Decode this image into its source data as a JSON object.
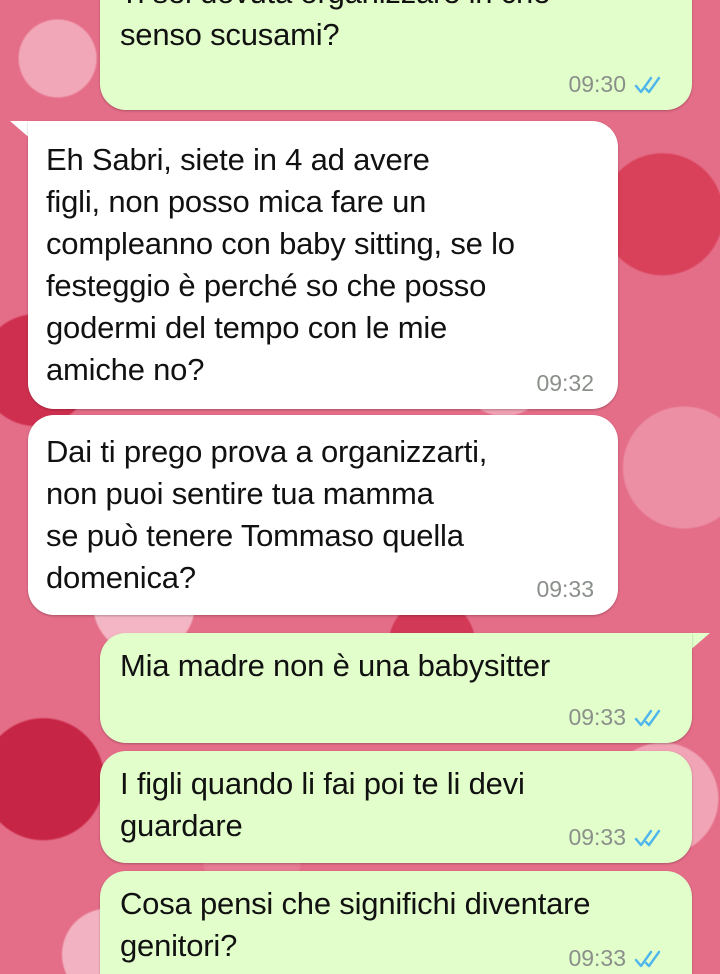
{
  "colors": {
    "outgoing_bubble": "#e2fecb",
    "incoming_bubble": "#ffffff",
    "timestamp": "#8a8f8a",
    "read_ticks": "#4fb6ec"
  },
  "messages": [
    {
      "direction": "outgoing",
      "text": "Ti sei dovuta organizzare in che\nsenso scusami?",
      "time": "09:30",
      "read": true
    },
    {
      "direction": "incoming",
      "text": "Eh Sabri, siete in 4 ad avere\nfigli, non posso mica fare un\ncompleanno con baby sitting, se lo\nfesteggio è perché so che posso\ngodermi del tempo con le mie\namiche no?",
      "time": "09:32"
    },
    {
      "direction": "incoming",
      "text": "Dai ti prego prova a organizzarti,\nnon puoi sentire tua mamma\nse può tenere Tommaso quella\ndomenica?",
      "time": "09:33"
    },
    {
      "direction": "outgoing",
      "text": "Mia madre non è una babysitter",
      "time": "09:33",
      "read": true
    },
    {
      "direction": "outgoing",
      "text": "I figli quando li fai poi te li devi\nguardare",
      "time": "09:33",
      "read": true
    },
    {
      "direction": "outgoing",
      "text": "Cosa pensi che significhi diventare\ngenitori?",
      "time": "09:33",
      "read": true
    }
  ]
}
